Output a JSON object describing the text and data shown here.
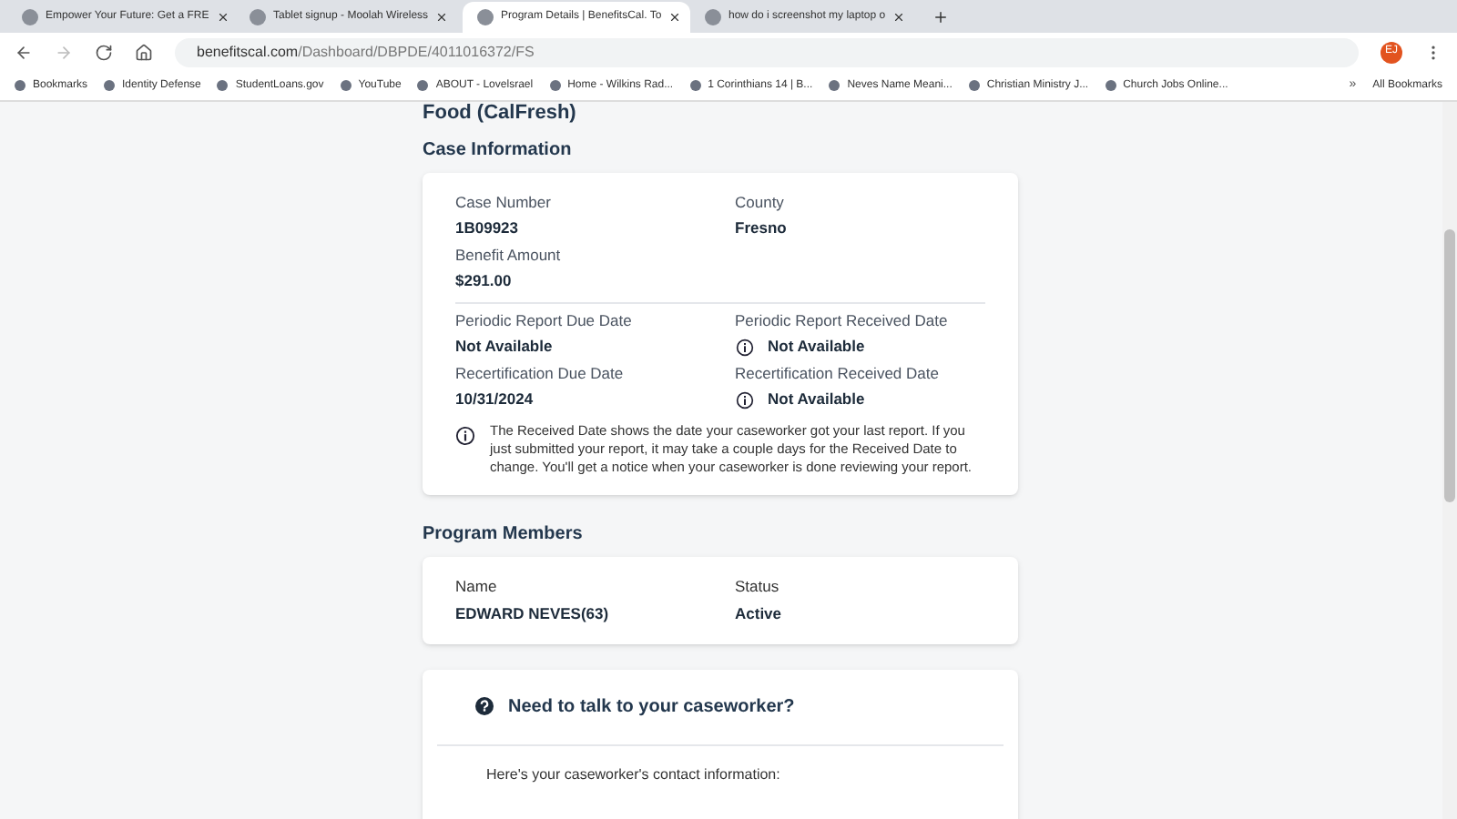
{
  "tabs": [
    {
      "title": "Empower Your Future: Get a FRE",
      "selected": false
    },
    {
      "title": "Tablet signup - Moolah Wireless",
      "selected": false
    },
    {
      "title": "Program Details | BenefitsCal. To",
      "selected": true
    },
    {
      "title": "how do i screenshot my laptop o",
      "selected": false
    }
  ],
  "address": {
    "domain": "benefitscal.com",
    "path": "/Dashboard/DBPDE/4011016372/FS"
  },
  "avatar": "EJ",
  "bookmarks": [
    "Bookmarks",
    "Identity Defense",
    "StudentLoans.gov",
    "YouTube",
    "ABOUT - Lovelsrael",
    "Home - Wilkins Rad...",
    "1 Corinthians 14 | B...",
    "Neves Name Meani...",
    "Christian Ministry J...",
    "Church Jobs Online..."
  ],
  "more_bookmarks": "»",
  "all_bookmarks": "All Bookmarks",
  "page_title": "Food (CalFresh)",
  "case_info": {
    "heading": "Case Information",
    "top_fields": [
      {
        "label": "Case Number",
        "value": "1B09923"
      },
      {
        "label": "County",
        "value": "Fresno"
      },
      {
        "label": "Benefit Amount",
        "value": "$291.00"
      }
    ],
    "date_fields": [
      {
        "label": "Periodic Report Due Date",
        "value": "Not Available",
        "kind": "plain"
      },
      {
        "label": "Periodic Report Received Date",
        "value": "Not Available",
        "kind": "info"
      },
      {
        "label": "Recertification Due Date",
        "value": "10/31/2024",
        "kind": "plain"
      },
      {
        "label": "Recertification Received Date",
        "value": "Not Available",
        "kind": "info"
      }
    ],
    "note": "The Received Date shows the date your caseworker got your last report. If you just submitted your report, it may take a couple days for the Received Date to change. You'll get a notice when your caseworker is done reviewing your report."
  },
  "members": {
    "heading": "Program Members",
    "columns": [
      "Name",
      "Status"
    ],
    "rows": [
      [
        "EDWARD NEVES(63)",
        "Active"
      ]
    ]
  },
  "contact": {
    "heading": "Need to talk to your caseworker?",
    "text": "Here's your caseworker's contact information:"
  }
}
